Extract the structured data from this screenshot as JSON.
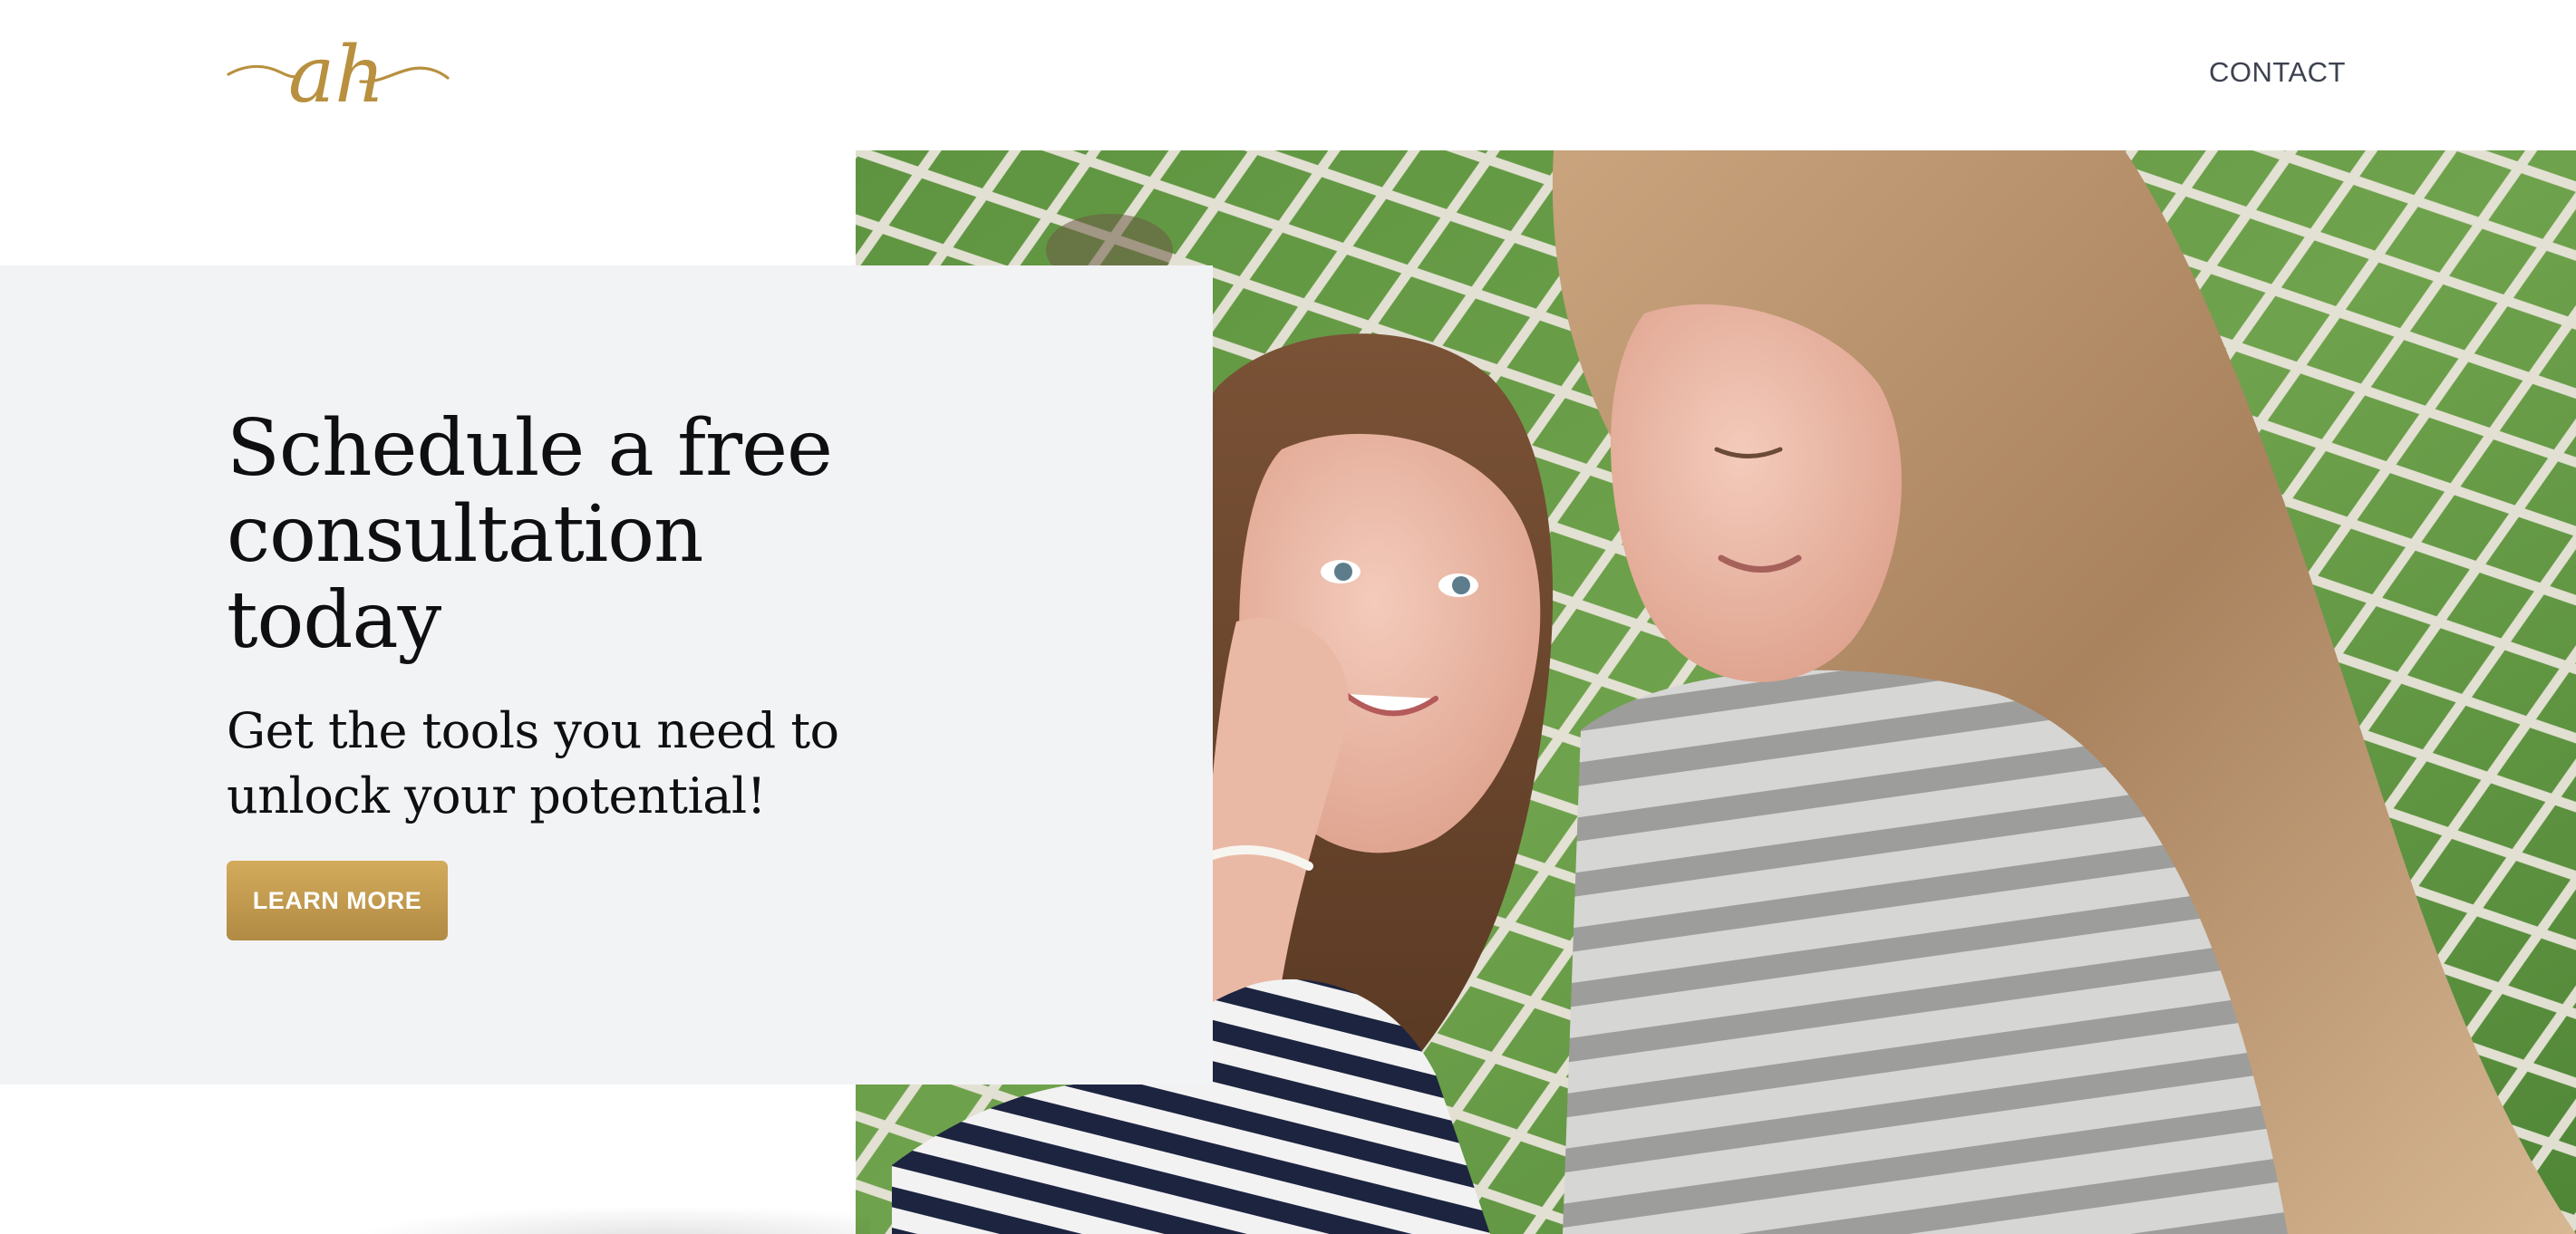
{
  "header": {
    "logo_text": "ah",
    "nav": {
      "contact_label": "CONTACT"
    }
  },
  "hero": {
    "heading": "Schedule a free consultation today",
    "subheading": "Get the tools you need to unlock your potential!",
    "cta_label": "LEARN MORE",
    "photo_subject": "mother-and-daughter-in-hammock"
  },
  "colors": {
    "accent_gold": "#b8903f",
    "card_gray": "#f2f3f5",
    "heading_text": "#0f0f12",
    "nav_text": "#3c4250"
  }
}
